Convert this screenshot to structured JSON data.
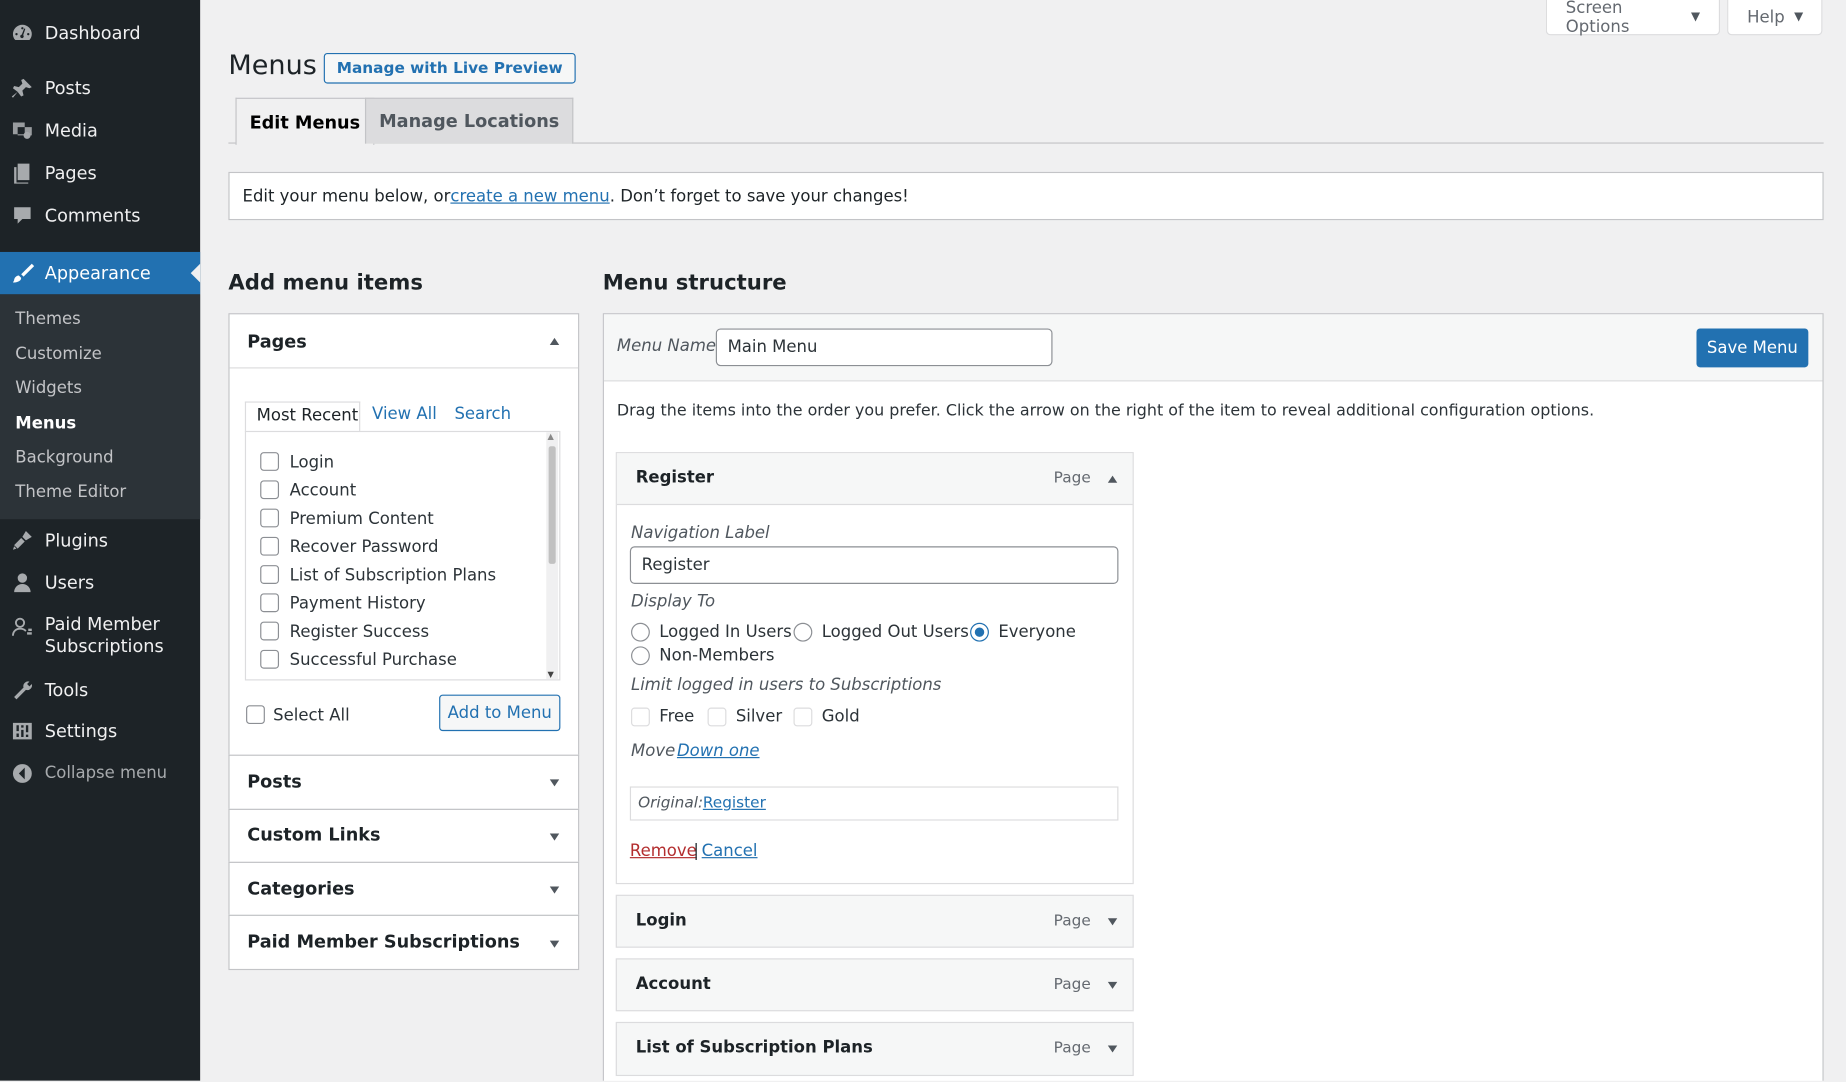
{
  "sidebar": {
    "items": [
      {
        "label": "Dashboard",
        "icon": "dashboard-icon"
      },
      {
        "label": "Posts",
        "icon": "pin-icon"
      },
      {
        "label": "Media",
        "icon": "media-icon"
      },
      {
        "label": "Pages",
        "icon": "pages-icon"
      },
      {
        "label": "Comments",
        "icon": "comment-icon"
      },
      {
        "label": "Appearance",
        "icon": "brush-icon"
      },
      {
        "label": "Plugins",
        "icon": "plugin-icon"
      },
      {
        "label": "Users",
        "icon": "user-icon"
      },
      {
        "label": "Paid Member Subscriptions",
        "icon": "members-icon"
      },
      {
        "label": "Tools",
        "icon": "wrench-icon"
      },
      {
        "label": "Settings",
        "icon": "settings-icon"
      },
      {
        "label": "Collapse menu",
        "icon": "collapse-icon"
      }
    ],
    "submenu": [
      "Themes",
      "Customize",
      "Widgets",
      "Menus",
      "Background",
      "Theme Editor"
    ],
    "paid_line1": "Paid Member",
    "paid_line2": "Subscriptions"
  },
  "screen_meta": {
    "screen_options": "Screen Options",
    "help": "Help"
  },
  "header": {
    "title": "Menus",
    "live_preview": "Manage with Live Preview"
  },
  "tabs": [
    "Edit Menus",
    "Manage Locations"
  ],
  "notice": {
    "before": "Edit your menu below, or ",
    "link": "create a new menu",
    "after": ". Don’t forget to save your changes!"
  },
  "add_items": {
    "heading": "Add menu items",
    "pages_title": "Pages",
    "page_tabs": [
      "Most Recent",
      "View All",
      "Search"
    ],
    "pages": [
      "Login",
      "Account",
      "Premium Content",
      "Recover Password",
      "List of Subscription Plans",
      "Payment History",
      "Register Success",
      "Successful Purchase"
    ],
    "select_all": "Select All",
    "add_button": "Add to Menu",
    "sections": [
      "Posts",
      "Custom Links",
      "Categories",
      "Paid Member Subscriptions"
    ]
  },
  "structure": {
    "heading": "Menu structure",
    "menu_name_label": "Menu Name",
    "menu_name_value": "Main Menu",
    "save_button": "Save Menu",
    "instructions": "Drag the items into the order you prefer. Click the arrow on the right of the item to reveal additional configuration options.",
    "items": [
      {
        "title": "Register",
        "type": "Page"
      },
      {
        "title": "Login",
        "type": "Page"
      },
      {
        "title": "Account",
        "type": "Page"
      },
      {
        "title": "List of Subscription Plans",
        "type": "Page"
      }
    ],
    "edit": {
      "nav_label_caption": "Navigation Label",
      "nav_label_value": "Register",
      "display_to_caption": "Display To",
      "display_options": [
        "Logged In Users",
        "Logged Out Users",
        "Everyone",
        "Non-Members"
      ],
      "display_selected": "Everyone",
      "limit_caption": "Limit logged in users to Subscriptions",
      "subscriptions": [
        "Free",
        "Silver",
        "Gold"
      ],
      "move_label": "Move",
      "move_link": "Down one",
      "original_label": "Original:",
      "original_link": "Register",
      "remove": "Remove",
      "separator": "|",
      "cancel": "Cancel"
    }
  },
  "colors": {
    "accent": "#2271b1",
    "sidebar": "#1d2327",
    "remove": "#b32d2e"
  }
}
